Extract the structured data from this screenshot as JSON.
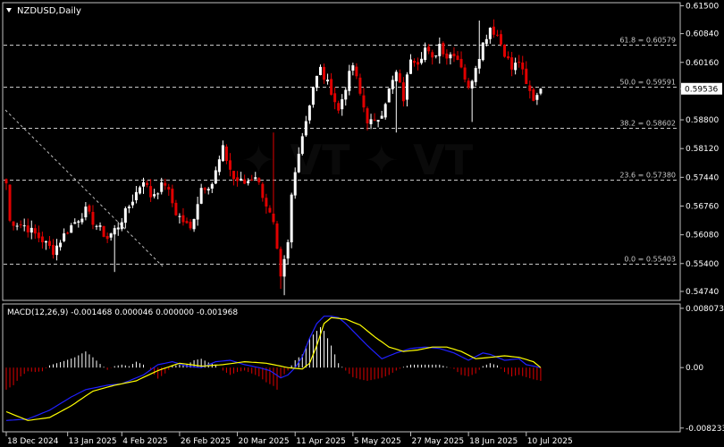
{
  "symbol_label": "NZDUSD,Daily",
  "colors": {
    "background": "#000000",
    "frame": "#c0c0c0",
    "text": "#ffffff",
    "bull": "#ffffff",
    "bear": "#e00000",
    "fib": "#c8c8c8",
    "macd_line": "#2020ff",
    "signal_line": "#ffff00",
    "hist_pos": "#ffffff",
    "hist_neg": "#e00000",
    "price_tag_bg": "#ffffff",
    "price_tag_text": "#000000"
  },
  "chart_data": [
    {
      "type": "candlestick",
      "title": "NZDUSD,Daily",
      "ylim": [
        0.5457,
        0.6153
      ],
      "y_ticks": [
        "0.61500",
        "0.60840",
        "0.60160",
        "0.59536",
        "0.58800",
        "0.58120",
        "0.57440",
        "0.56760",
        "0.56080",
        "0.55400",
        "0.54740"
      ],
      "x_tick_labels": [
        "18 Dec 2024",
        "13 Jan 2025",
        "4 Feb 2025",
        "26 Feb 2025",
        "20 Mar 2025",
        "11 Apr 2025",
        "5 May 2025",
        "27 May 2025",
        "18 Jun 2025",
        "10 Jul 2025"
      ],
      "x_tick_index": [
        0,
        17,
        32,
        48,
        64,
        80,
        96,
        112,
        128,
        144
      ],
      "current_price": "0.59536",
      "current_value": 0.59536,
      "fib_levels": [
        {
          "label": "61.8 = 0.60579",
          "value": 0.60579
        },
        {
          "label": "50.0 = 0.59591",
          "value": 0.59591
        },
        {
          "label": "38.2 = 0.58602",
          "value": 0.58602
        },
        {
          "label": "23.6 = 0.57380",
          "value": 0.5738
        },
        {
          "label": "0.0 = 0.55403",
          "value": 0.55403
        }
      ],
      "close_anchors": [
        [
          0,
          0.573
        ],
        [
          1,
          0.564
        ],
        [
          5,
          0.563
        ],
        [
          10,
          0.5595
        ],
        [
          13,
          0.557
        ],
        [
          17,
          0.562
        ],
        [
          22,
          0.5665
        ],
        [
          24,
          0.564
        ],
        [
          28,
          0.56
        ],
        [
          31,
          0.563
        ],
        [
          33,
          0.566
        ],
        [
          38,
          0.574
        ],
        [
          40,
          0.57
        ],
        [
          44,
          0.573
        ],
        [
          47,
          0.566
        ],
        [
          51,
          0.562
        ],
        [
          54,
          0.572
        ],
        [
          57,
          0.573
        ],
        [
          60,
          0.581
        ],
        [
          63,
          0.574
        ],
        [
          66,
          0.573
        ],
        [
          69,
          0.575
        ],
        [
          72,
          0.568
        ],
        [
          74,
          0.563
        ],
        [
          76,
          0.55
        ],
        [
          78,
          0.5585
        ],
        [
          79,
          0.57
        ],
        [
          81,
          0.581
        ],
        [
          83,
          0.588
        ],
        [
          85,
          0.596
        ],
        [
          87,
          0.6
        ],
        [
          88,
          0.598
        ],
        [
          90,
          0.595
        ],
        [
          92,
          0.59
        ],
        [
          94,
          0.596
        ],
        [
          96,
          0.601
        ],
        [
          98,
          0.594
        ],
        [
          100,
          0.588
        ],
        [
          102,
          0.587
        ],
        [
          104,
          0.59
        ],
        [
          106,
          0.595
        ],
        [
          108,
          0.599
        ],
        [
          110,
          0.593
        ],
        [
          112,
          0.603
        ],
        [
          114,
          0.602
        ],
        [
          116,
          0.605
        ],
        [
          118,
          0.602
        ],
        [
          120,
          0.606
        ],
        [
          122,
          0.603
        ],
        [
          124,
          0.604
        ],
        [
          126,
          0.601
        ],
        [
          128,
          0.595
        ],
        [
          130,
          0.601
        ],
        [
          132,
          0.606
        ],
        [
          134,
          0.61
        ],
        [
          136,
          0.608
        ],
        [
          138,
          0.604
        ],
        [
          140,
          0.6
        ],
        [
          142,
          0.602
        ],
        [
          144,
          0.596
        ],
        [
          146,
          0.593
        ],
        [
          148,
          0.5954
        ]
      ],
      "closes": [],
      "opens": [],
      "highs": [],
      "lows": []
    },
    {
      "type": "macd",
      "title": "MACD(12,26,9) -0.001468 0.000046 0.000000 -0.001968",
      "parameters": [
        12,
        26,
        9
      ],
      "ylim": [
        -0.0085,
        0.0083
      ],
      "y_ticks": [
        "0.008073",
        "0.00",
        "-0.008233"
      ],
      "y_tick_values": [
        0.008073,
        0,
        -0.008233
      ],
      "hist_anchors": [
        [
          0,
          -0.003
        ],
        [
          2,
          -0.0024
        ],
        [
          4,
          -0.0012
        ],
        [
          6,
          -0.0005
        ],
        [
          8,
          -0.0006
        ],
        [
          10,
          -0.0005
        ],
        [
          12,
          0.0003
        ],
        [
          14,
          0.0006
        ],
        [
          16,
          0.0009
        ],
        [
          19,
          0.0014
        ],
        [
          22,
          0.0022
        ],
        [
          24,
          0.0014
        ],
        [
          26,
          0.0005
        ],
        [
          28,
          -0.0003
        ],
        [
          30,
          0.0002
        ],
        [
          32,
          0.0004
        ],
        [
          34,
          0.0002
        ],
        [
          36,
          0.0008
        ],
        [
          38,
          0.0004
        ],
        [
          40,
          -0.0004
        ],
        [
          42,
          -0.0015
        ],
        [
          44,
          -0.0008
        ],
        [
          46,
          0.0002
        ],
        [
          48,
          0.0004
        ],
        [
          50,
          0.0004
        ],
        [
          52,
          0.001
        ],
        [
          54,
          0.0012
        ],
        [
          56,
          0.0007
        ],
        [
          58,
          0.0004
        ],
        [
          60,
          -0.0004
        ],
        [
          62,
          -0.001
        ],
        [
          64,
          -0.0006
        ],
        [
          66,
          -0.0004
        ],
        [
          68,
          -0.0008
        ],
        [
          70,
          -0.0012
        ],
        [
          72,
          -0.002
        ],
        [
          74,
          -0.0025
        ],
        [
          75,
          -0.003
        ],
        [
          76,
          -0.0014
        ],
        [
          78,
          -0.0004
        ],
        [
          80,
          0.001
        ],
        [
          82,
          0.0018
        ],
        [
          84,
          0.004
        ],
        [
          86,
          0.005
        ],
        [
          87,
          0.0055
        ],
        [
          88,
          0.005
        ],
        [
          90,
          0.003
        ],
        [
          92,
          0.0006
        ],
        [
          94,
          -0.0004
        ],
        [
          96,
          -0.0013
        ],
        [
          98,
          -0.0016
        ],
        [
          100,
          -0.0018
        ],
        [
          102,
          -0.0016
        ],
        [
          104,
          -0.0014
        ],
        [
          106,
          -0.001
        ],
        [
          108,
          -0.0004
        ],
        [
          110,
          0.0001
        ],
        [
          112,
          0.0004
        ],
        [
          114,
          0.0004
        ],
        [
          116,
          0.0004
        ],
        [
          118,
          0.0004
        ],
        [
          120,
          0.0004
        ],
        [
          122,
          0.0001
        ],
        [
          124,
          -0.0002
        ],
        [
          126,
          -0.001
        ],
        [
          128,
          -0.0012
        ],
        [
          130,
          -0.0008
        ],
        [
          132,
          0.0002
        ],
        [
          134,
          0.0006
        ],
        [
          136,
          0.0003
        ],
        [
          138,
          -0.0006
        ],
        [
          140,
          -0.0012
        ],
        [
          142,
          -0.001
        ],
        [
          144,
          -0.0013
        ],
        [
          146,
          -0.0016
        ],
        [
          148,
          -0.0018
        ]
      ],
      "macd_anchors": [
        [
          0,
          -0.0072
        ],
        [
          6,
          -0.007
        ],
        [
          12,
          -0.0058
        ],
        [
          18,
          -0.004
        ],
        [
          22,
          -0.003
        ],
        [
          28,
          -0.0024
        ],
        [
          32,
          -0.0022
        ],
        [
          38,
          -0.001
        ],
        [
          42,
          0.0004
        ],
        [
          46,
          0.0008
        ],
        [
          50,
          0.0002
        ],
        [
          54,
          0.0
        ],
        [
          58,
          0.0008
        ],
        [
          62,
          0.001
        ],
        [
          66,
          0.0004
        ],
        [
          70,
          0.0
        ],
        [
          73,
          -0.0004
        ],
        [
          76,
          -0.0014
        ],
        [
          78,
          -0.001
        ],
        [
          80,
          0.0
        ],
        [
          82,
          0.0015
        ],
        [
          84,
          0.004
        ],
        [
          86,
          0.006
        ],
        [
          88,
          0.007
        ],
        [
          90,
          0.007
        ],
        [
          92,
          0.0068
        ],
        [
          94,
          0.006
        ],
        [
          96,
          0.005
        ],
        [
          98,
          0.004
        ],
        [
          100,
          0.003
        ],
        [
          104,
          0.0012
        ],
        [
          108,
          0.002
        ],
        [
          112,
          0.0026
        ],
        [
          116,
          0.0028
        ],
        [
          120,
          0.0026
        ],
        [
          124,
          0.002
        ],
        [
          128,
          0.001
        ],
        [
          132,
          0.002
        ],
        [
          134,
          0.0018
        ],
        [
          138,
          0.001
        ],
        [
          142,
          0.0012
        ],
        [
          144,
          0.0004
        ],
        [
          148,
          0.0
        ]
      ],
      "signal_anchors": [
        [
          0,
          -0.006
        ],
        [
          6,
          -0.0072
        ],
        [
          12,
          -0.0068
        ],
        [
          18,
          -0.0052
        ],
        [
          24,
          -0.0032
        ],
        [
          30,
          -0.0024
        ],
        [
          36,
          -0.0018
        ],
        [
          42,
          -0.0004
        ],
        [
          48,
          0.0006
        ],
        [
          54,
          0.0002
        ],
        [
          60,
          0.0004
        ],
        [
          66,
          0.0008
        ],
        [
          72,
          0.0006
        ],
        [
          78,
          0.0
        ],
        [
          82,
          -0.0002
        ],
        [
          84,
          0.0006
        ],
        [
          86,
          0.003
        ],
        [
          88,
          0.006
        ],
        [
          90,
          0.0068
        ],
        [
          94,
          0.0066
        ],
        [
          98,
          0.0058
        ],
        [
          102,
          0.0042
        ],
        [
          106,
          0.0028
        ],
        [
          110,
          0.0022
        ],
        [
          114,
          0.0024
        ],
        [
          118,
          0.0028
        ],
        [
          122,
          0.0028
        ],
        [
          126,
          0.0022
        ],
        [
          130,
          0.0012
        ],
        [
          134,
          0.0014
        ],
        [
          138,
          0.0016
        ],
        [
          142,
          0.0014
        ],
        [
          146,
          0.0008
        ],
        [
          148,
          0.0
        ]
      ]
    }
  ]
}
